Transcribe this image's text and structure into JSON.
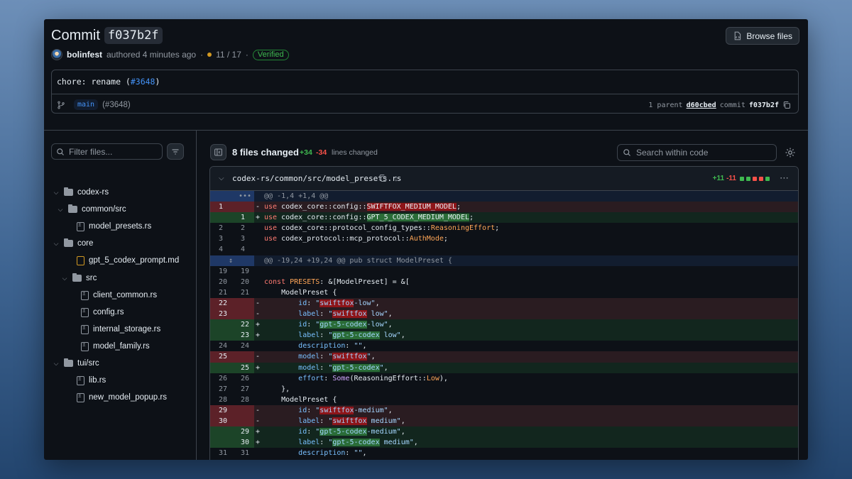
{
  "header": {
    "title_prefix": "Commit",
    "sha": "f037b2f",
    "browse_label": "Browse files",
    "author": "bolinfest",
    "authored": "authored 4 minutes ago",
    "sep": "·",
    "checks": "11 / 17",
    "verified": "Verified"
  },
  "message": {
    "text": "chore: rename (",
    "link": "#3648",
    "close": ")",
    "branch": "main",
    "branch_pr": "(#3648)",
    "parent_label": "1 parent",
    "parent_sha": "d60cbed",
    "commit_label": "commit",
    "commit_sha": "f037b2f"
  },
  "sidebar": {
    "filter_placeholder": "Filter files...",
    "tree": [
      {
        "label": "codex-rs",
        "kind": "folder"
      },
      {
        "label": "common/src",
        "kind": "folder"
      },
      {
        "label": "model_presets.rs",
        "kind": "file"
      },
      {
        "label": "core",
        "kind": "folder"
      },
      {
        "label": "gpt_5_codex_prompt.md",
        "kind": "file-moved"
      },
      {
        "label": "src",
        "kind": "folder"
      },
      {
        "label": "client_common.rs",
        "kind": "file"
      },
      {
        "label": "config.rs",
        "kind": "file"
      },
      {
        "label": "internal_storage.rs",
        "kind": "file"
      },
      {
        "label": "model_family.rs",
        "kind": "file"
      },
      {
        "label": "tui/src",
        "kind": "folder"
      },
      {
        "label": "lib.rs",
        "kind": "file"
      },
      {
        "label": "new_model_popup.rs",
        "kind": "file"
      }
    ]
  },
  "summary": {
    "files_changed": "8 files changed",
    "additions": "+34",
    "deletions": "-34",
    "lines_label": "lines changed",
    "search_placeholder": "Search within code"
  },
  "diff": {
    "path": "codex-rs/common/src/model_presets.rs",
    "additions": "+11",
    "deletions": "-11",
    "hunk1_dots": "•••",
    "hunk1": "@@ -1,4 +1,4 @@",
    "hunk2_icon": "↕",
    "hunk2": "@@ -19,24 +19,24 @@ pub struct ModelPreset {"
  },
  "colors": {
    "accent": "#4493f8",
    "add": "#3fb950",
    "del": "#f85149",
    "bg": "#0d1117"
  }
}
